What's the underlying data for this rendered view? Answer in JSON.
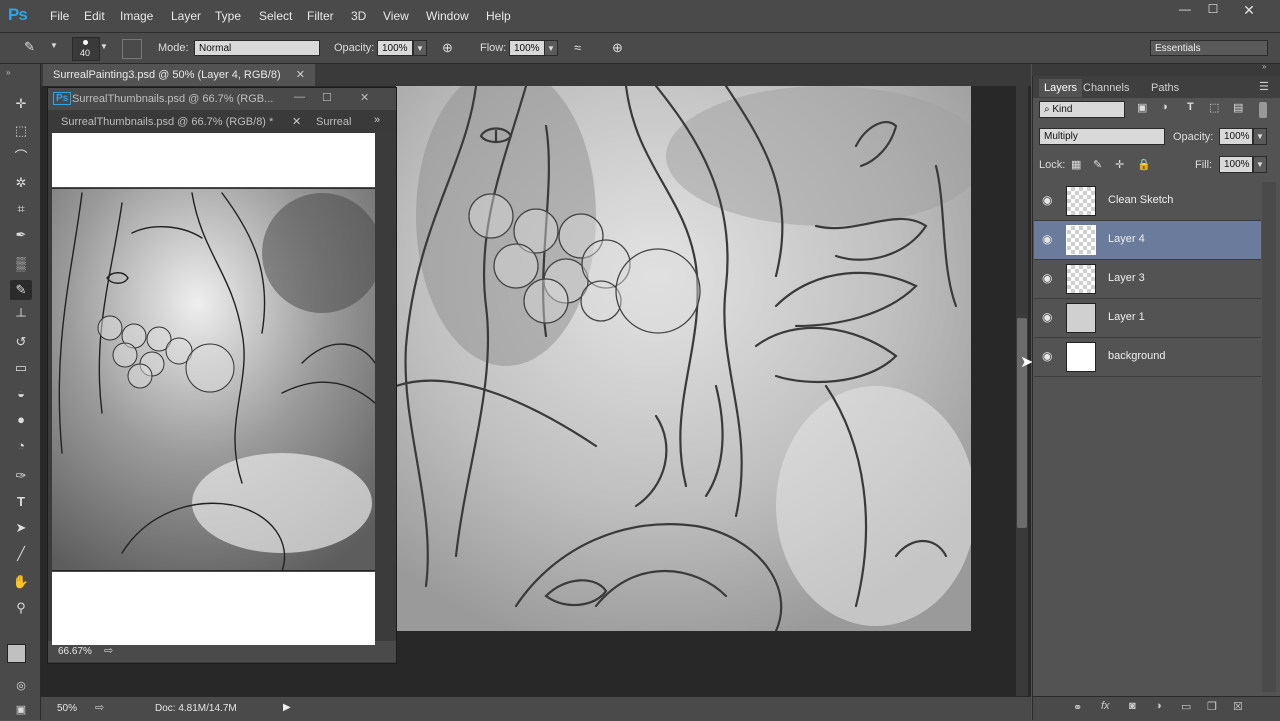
{
  "menubar": {
    "logo": "Ps",
    "items": [
      "File",
      "Edit",
      "Image",
      "Layer",
      "Type",
      "Select",
      "Filter",
      "3D",
      "View",
      "Window",
      "Help"
    ]
  },
  "options": {
    "brush_size": "40",
    "mode_label": "Mode:",
    "mode_value": "Normal",
    "opacity_label": "Opacity:",
    "opacity_value": "100%",
    "flow_label": "Flow:",
    "flow_value": "100%",
    "workspace": "Essentials"
  },
  "document": {
    "main_tab": "SurrealPainting3.psd @ 50% (Layer 4, RGB/8)",
    "float_title": "SurrealThumbnails.psd @ 66.7% (RGB...",
    "float_tab1": "SurrealThumbnails.psd @ 66.7% (RGB/8) *",
    "float_tab2": "Surreal",
    "float_zoom": "66.67%",
    "status_zoom": "50%",
    "status_doc": "Doc: 4.81M/14.7M"
  },
  "layers_panel": {
    "tabs": [
      "Layers",
      "Channels",
      "Paths"
    ],
    "kind": "Kind",
    "blend_mode": "Multiply",
    "opacity_label": "Opacity:",
    "opacity_value": "100%",
    "lock_label": "Lock:",
    "fill_label": "Fill:",
    "fill_value": "100%",
    "layers": [
      {
        "name": "Clean Sketch",
        "selected": false,
        "thumb": "transparent"
      },
      {
        "name": "Layer 4",
        "selected": true,
        "thumb": "transparent"
      },
      {
        "name": "Layer 3",
        "selected": false,
        "thumb": "transparent"
      },
      {
        "name": "Layer 1",
        "selected": false,
        "thumb": "gray"
      },
      {
        "name": "background",
        "selected": false,
        "thumb": "white"
      }
    ]
  },
  "colors": {
    "accent": "#2fa3e6",
    "selected_layer": "#6a7b9c",
    "panel": "#535353"
  }
}
